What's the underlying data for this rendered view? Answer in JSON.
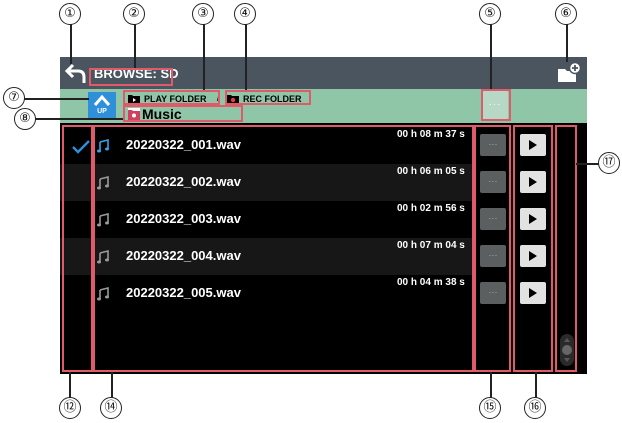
{
  "header": {
    "title": "BROWSE: SD"
  },
  "path": {
    "play_folder_label": "PLAY FOLDER",
    "separator": "/",
    "rec_folder_label": "REC FOLDER",
    "up_label": "UP",
    "current_folder": "Music"
  },
  "files": [
    {
      "name": "20220322_001.wav",
      "hours": "00",
      "minutes": "08",
      "seconds": "37",
      "selected": true
    },
    {
      "name": "20220322_002.wav",
      "hours": "00",
      "minutes": "06",
      "seconds": "05",
      "selected": false
    },
    {
      "name": "20220322_003.wav",
      "hours": "00",
      "minutes": "02",
      "seconds": "56",
      "selected": false
    },
    {
      "name": "20220322_004.wav",
      "hours": "00",
      "minutes": "07",
      "seconds": "04",
      "selected": false
    },
    {
      "name": "20220322_005.wav",
      "hours": "00",
      "minutes": "04",
      "seconds": "38",
      "selected": false
    }
  ],
  "units": {
    "h": "h",
    "m": "m",
    "s": "s"
  },
  "callouts": [
    "①",
    "②",
    "③",
    "④",
    "⑤",
    "⑥",
    "⑦",
    "⑧",
    "⑫",
    "⑭",
    "⑮",
    "⑯",
    "⑰"
  ],
  "colors": {
    "screen": "#000000",
    "titlebar": "#4b5560",
    "pathbar": "#8ec6a7",
    "highlight": "#e05a6a",
    "accent": "#2f8fd8"
  }
}
